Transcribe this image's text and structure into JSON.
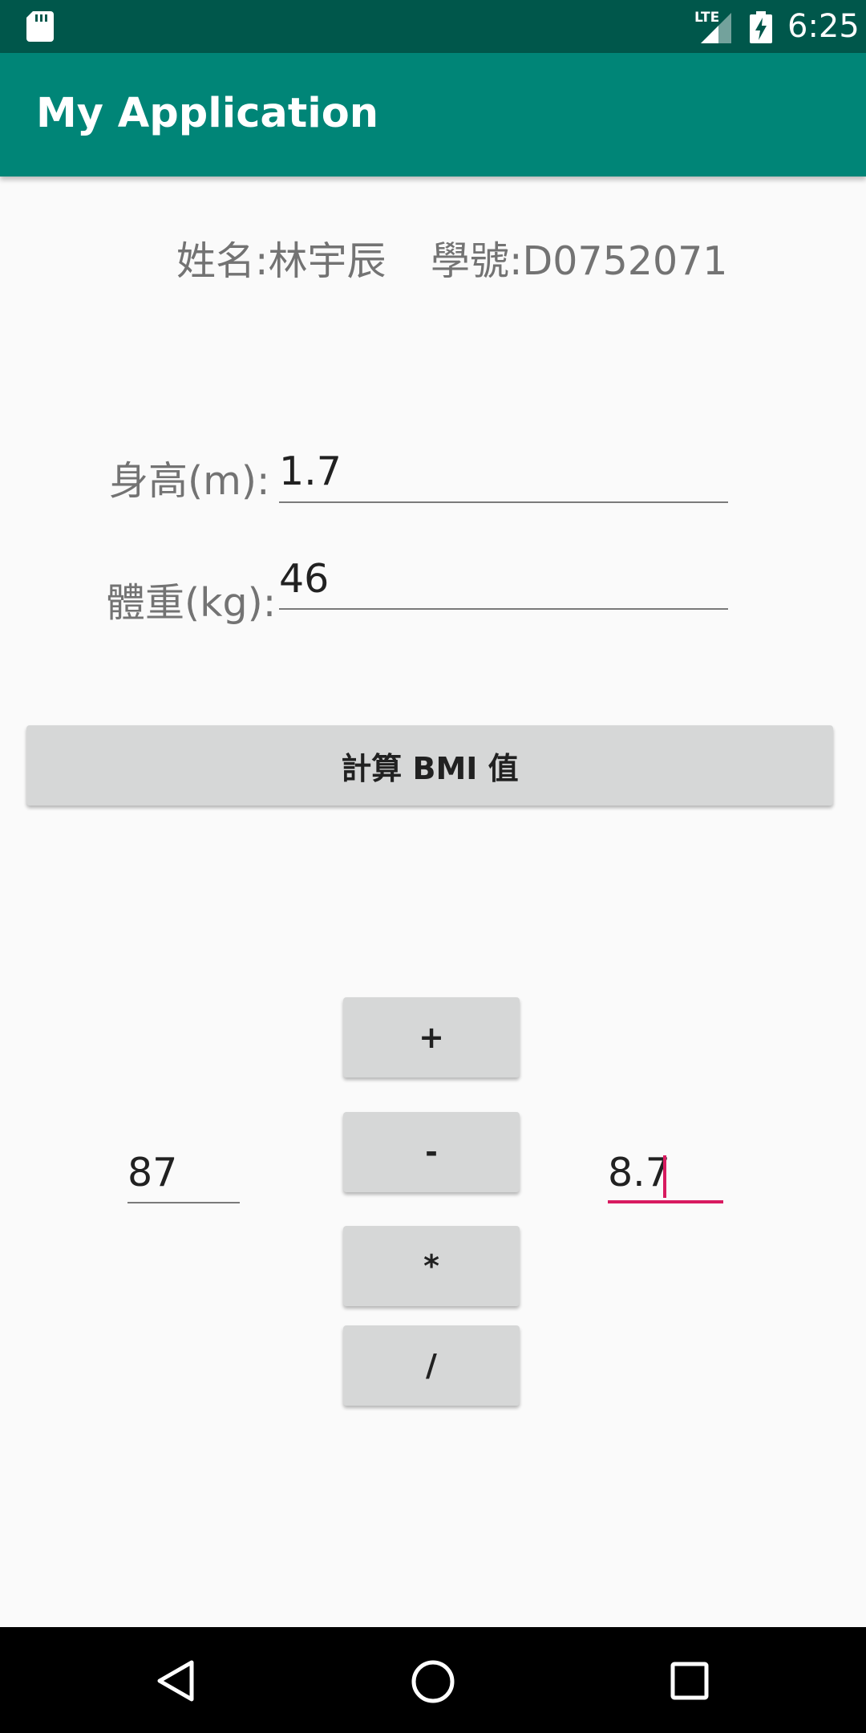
{
  "status_bar": {
    "network": "LTE",
    "time": "6:25",
    "icons": [
      "sd-card-icon",
      "signal-icon",
      "battery-charging-icon"
    ]
  },
  "app_bar": {
    "title": "My Application"
  },
  "student": {
    "name": "姓名:林宇辰",
    "id": "學號:D0752071"
  },
  "form": {
    "height_label": "身高(m):",
    "height_value": "1.7",
    "weight_label": "體重(kg):",
    "weight_value": "46"
  },
  "bmi_button": {
    "label": "計算 BMI 值"
  },
  "calculator": {
    "left_value": "87",
    "right_value": "8.7",
    "operators": {
      "plus": "+",
      "minus": "-",
      "multiply": "*",
      "divide": "/"
    }
  },
  "nav_bar": {
    "icons": [
      "back-icon",
      "home-icon",
      "recents-icon"
    ]
  },
  "colors": {
    "status_bar": "#00574b",
    "app_bar": "#008577",
    "accent": "#d81b60",
    "button": "#d6d7d7"
  }
}
